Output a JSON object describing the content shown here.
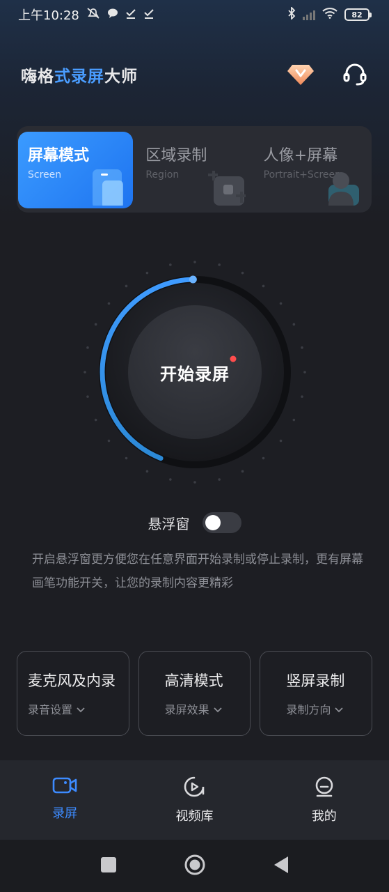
{
  "status_bar": {
    "time": "上午10:28",
    "battery": "82"
  },
  "header": {
    "title_part1": "嗨格",
    "title_accent": "式录屏",
    "title_part2": "大师"
  },
  "mode_tabs": [
    {
      "title": "屏幕模式",
      "subtitle": "Screen",
      "active": true
    },
    {
      "title": "区域录制",
      "subtitle": "Region",
      "active": false
    },
    {
      "title": "人像+屏幕",
      "subtitle": "Portrait+Screen",
      "active": false
    }
  ],
  "record_button": {
    "label": "开始录屏"
  },
  "floating_window": {
    "label": "悬浮窗",
    "enabled": false,
    "description": "开启悬浮窗更方便您在任意界面开始录制或停止录制，更有屏幕画笔功能开关，让您的录制内容更精彩"
  },
  "settings_cards": [
    {
      "title": "麦克风及内录",
      "subtitle": "录音设置"
    },
    {
      "title": "高清模式",
      "subtitle": "录屏效果"
    },
    {
      "title": "竖屏录制",
      "subtitle": "录制方向"
    }
  ],
  "bottom_nav": [
    {
      "label": "录屏",
      "icon": "video-camera-icon",
      "active": true
    },
    {
      "label": "视频库",
      "icon": "video-library-icon",
      "active": false
    },
    {
      "label": "我的",
      "icon": "profile-icon",
      "active": false
    }
  ],
  "colors": {
    "accent": "#3d8bff",
    "background": "#1d1e23",
    "notification_dot": "#ff4d4d"
  }
}
